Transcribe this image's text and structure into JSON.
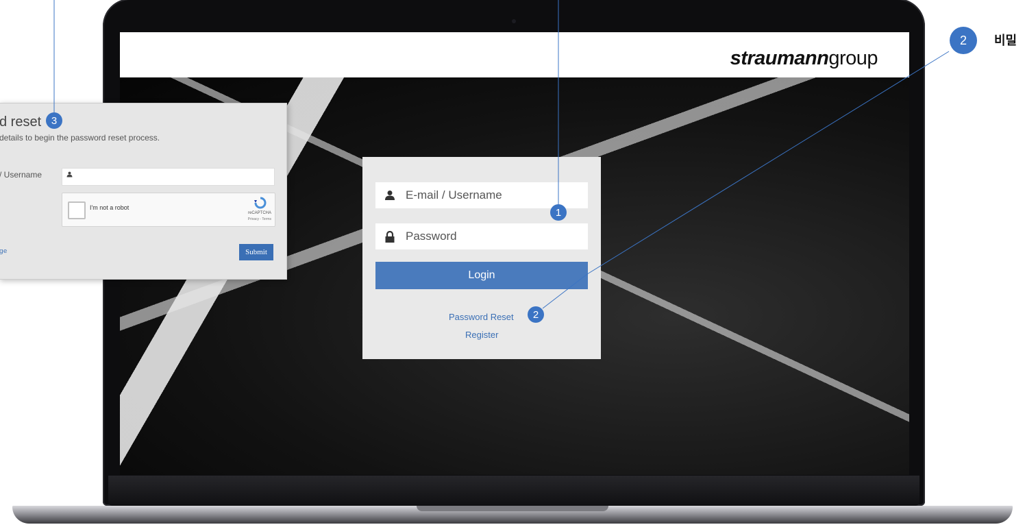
{
  "brand": {
    "bold": "straumann",
    "light": "group"
  },
  "login": {
    "email_placeholder": "E-mail / Username",
    "password_placeholder": "Password",
    "login_label": "Login",
    "password_reset_link": "Password Reset",
    "register_link": "Register"
  },
  "reset_panel": {
    "title": "d reset",
    "subtitle": "details to begin the password reset process.",
    "field_label": "/ Username",
    "captcha_label": "I'm not a robot",
    "captcha_brand": "reCAPTCHA",
    "captcha_links": "Privacy - Terms",
    "left_link": "ge",
    "submit_label": "Submit"
  },
  "callouts": {
    "one": "1",
    "two": "2",
    "three": "3",
    "two_right": "2",
    "note_text": "비밀"
  },
  "icons": {
    "user": "user-icon",
    "lock": "lock-icon",
    "recaptcha": "recaptcha-logo-icon"
  },
  "colors": {
    "accent": "#4a7bbd",
    "callout": "#3b74c4",
    "link": "#3a6fb5",
    "login_panel_bg": "#e9e9e9"
  }
}
